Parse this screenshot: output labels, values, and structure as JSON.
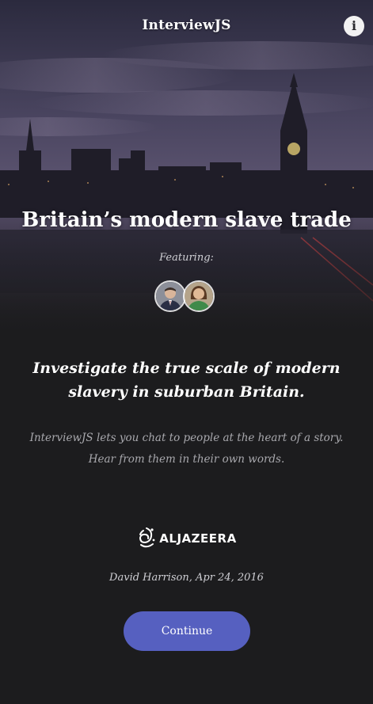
{
  "header": {
    "app_title": "InterviewJS",
    "info_icon": "info-icon",
    "info_glyph": "i"
  },
  "hero": {
    "title": "Britain’s modern slave trade",
    "featuring_label": "Featuring:",
    "interviewees": [
      {
        "name": "avatar-man-suit"
      },
      {
        "name": "avatar-woman-green"
      }
    ]
  },
  "story": {
    "headline": "Investigate the true scale of modern slavery in suburban Britain.",
    "intro": "InterviewJS lets you chat to people at the heart of a story. Hear from them in their own words."
  },
  "publisher": {
    "logo_icon": "aljazeera-logo-icon",
    "name": "ALJAZEERA"
  },
  "byline": "David Harrison, Apr 24, 2016",
  "actions": {
    "continue_label": "Continue"
  },
  "colors": {
    "background": "#1c1c1e",
    "accent": "#5660c0",
    "muted_text": "#a8a8ad"
  }
}
